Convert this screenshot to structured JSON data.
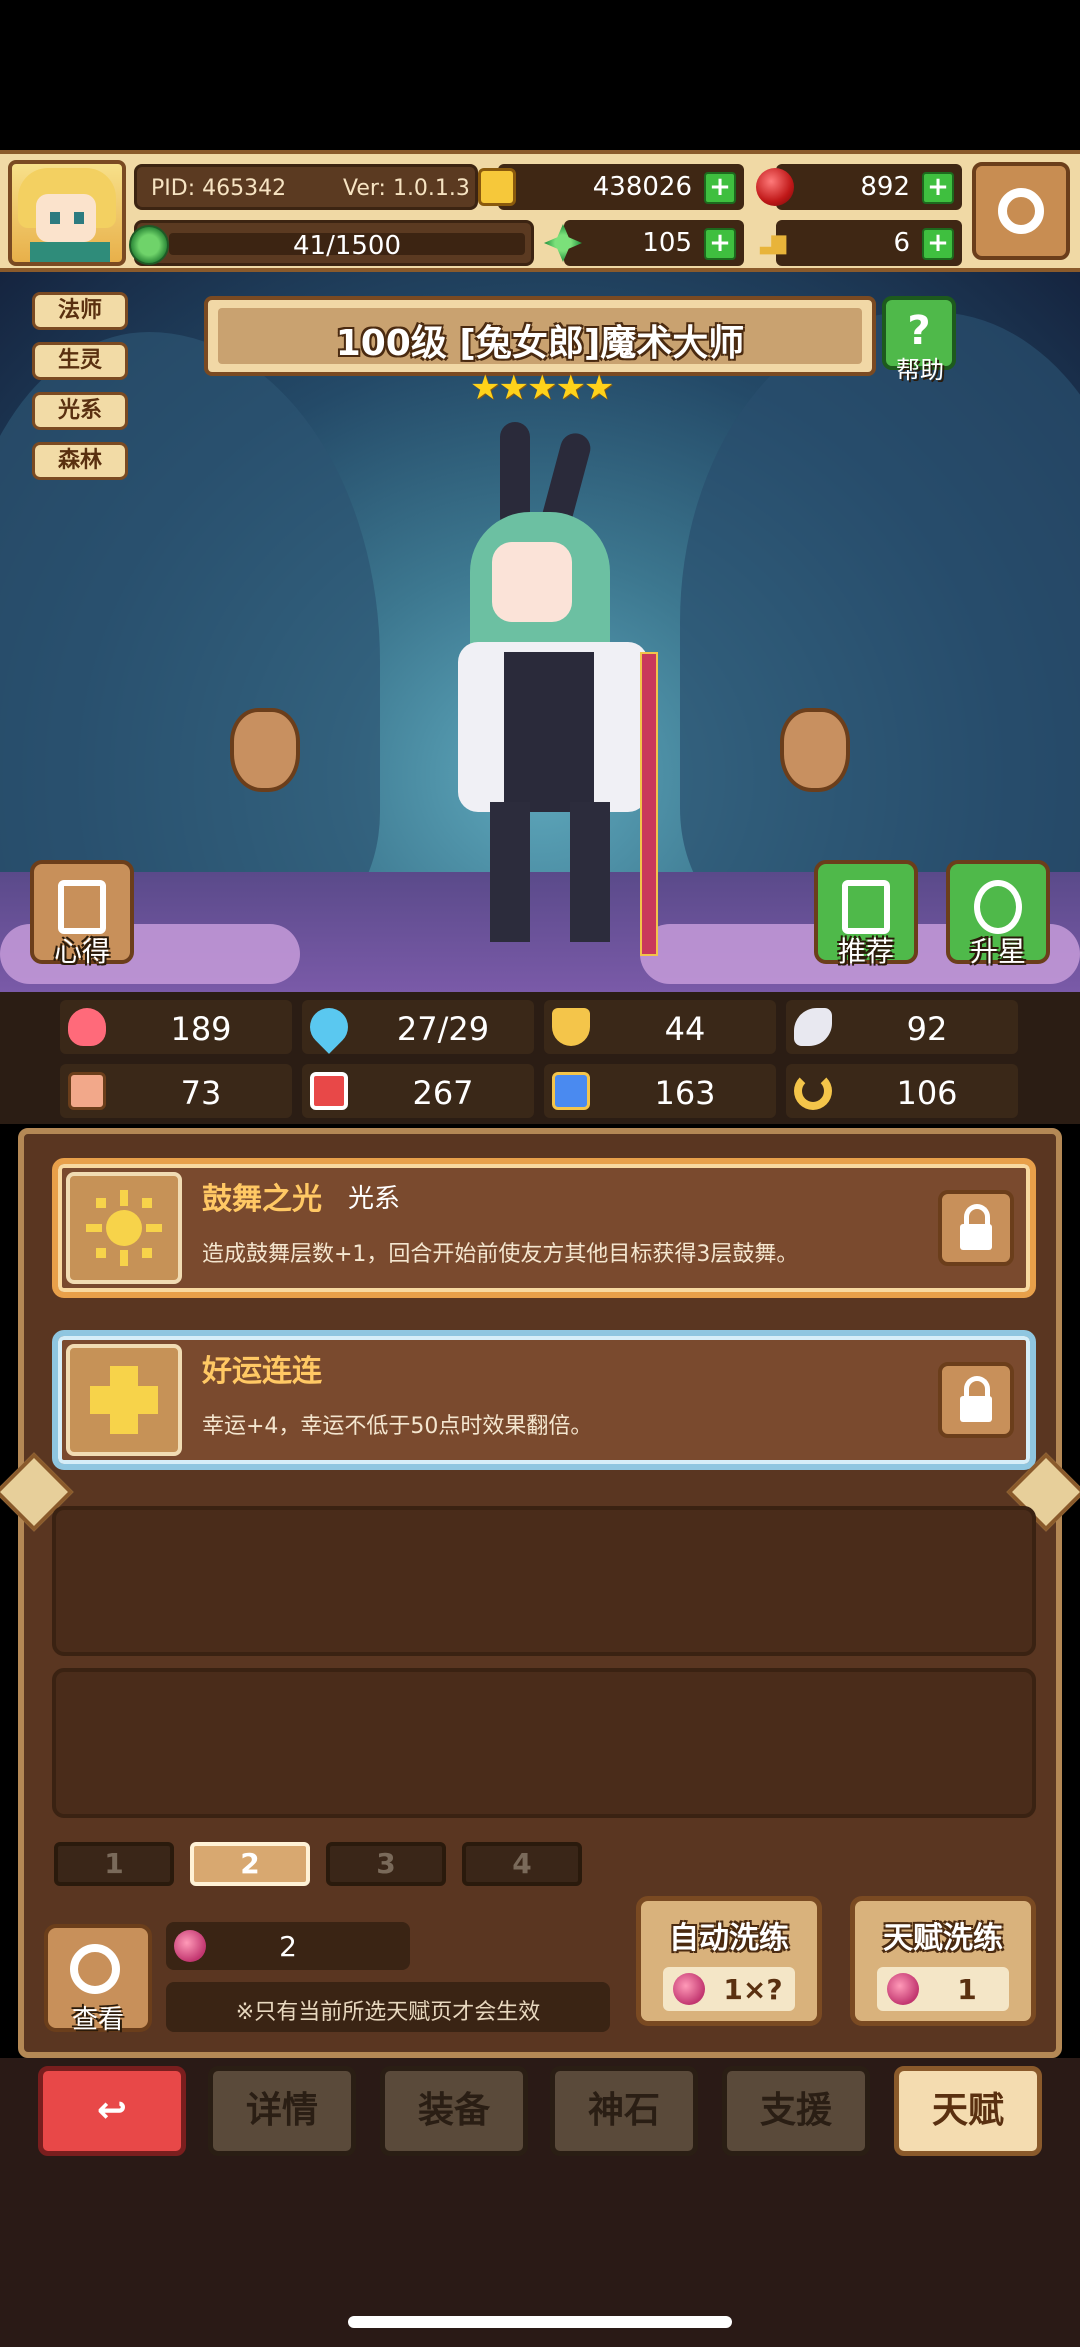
{
  "topbar": {
    "pid": "PID: 465342",
    "version": "Ver: 1.0.1.3",
    "xp": "41/1500",
    "resources": [
      {
        "name": "gold",
        "value": "438026",
        "icon": "gold-coin-icon",
        "color": "#f6c83a"
      },
      {
        "name": "ruby",
        "value": "892",
        "icon": "ruby-icon",
        "color": "#c01818"
      },
      {
        "name": "clover",
        "value": "105",
        "icon": "clover-icon",
        "color": "#1f8f3a"
      },
      {
        "name": "key",
        "value": "6",
        "icon": "key-icon",
        "color": "#e8b43a"
      }
    ],
    "plus": "+"
  },
  "tags": [
    "法师",
    "生灵",
    "光系",
    "森林"
  ],
  "hero": {
    "title": "100级 [兔女郎]魔术大师",
    "stars": "★★★★★",
    "star_count": 5,
    "help_label": "帮助",
    "help_glyph": "?",
    "insight_label": "心得",
    "recommend_label": "推荐",
    "upgrade_label": "升星"
  },
  "stats": [
    {
      "icon": "heart-icon",
      "value": "189",
      "color": "#ff6a7a"
    },
    {
      "icon": "mana-drop-icon",
      "value": "27/29",
      "color": "#5ac8f0"
    },
    {
      "icon": "shield-icon",
      "value": "44",
      "color": "#f4c54a"
    },
    {
      "icon": "wing-icon",
      "value": "92",
      "color": "#e8e8f0"
    },
    {
      "icon": "fist-icon",
      "value": "73",
      "color": "#f2a88a"
    },
    {
      "icon": "book-icon",
      "value": "267",
      "color": "#e84848"
    },
    {
      "icon": "boot-icon",
      "value": "163",
      "color": "#4a8af0"
    },
    {
      "icon": "horseshoe-icon",
      "value": "106",
      "color": "#f4c54a"
    }
  ],
  "talents": [
    {
      "name": "鼓舞之光",
      "element": "光系",
      "desc": "造成鼓舞层数+1，回合开始前使友方其他目标获得3层鼓舞。",
      "icon": "sun-icon"
    },
    {
      "name": "好运连连",
      "element": "",
      "desc": "幸运+4，幸运不低于50点时效果翻倍。",
      "icon": "cross-icon"
    }
  ],
  "pages": [
    "1",
    "2",
    "3",
    "4"
  ],
  "active_page": "2",
  "bottom_panel": {
    "view_label": "查看",
    "fruit_count": "2",
    "note": "※只有当前所选天赋页才会生效",
    "auto_wash": {
      "title": "自动洗练",
      "cost": "1×?"
    },
    "talent_wash": {
      "title": "天赋洗练",
      "cost": "1"
    }
  },
  "nav": {
    "back_glyph": "↩",
    "items": [
      "详情",
      "装备",
      "神石",
      "支援",
      "天赋"
    ],
    "active": "天赋"
  }
}
